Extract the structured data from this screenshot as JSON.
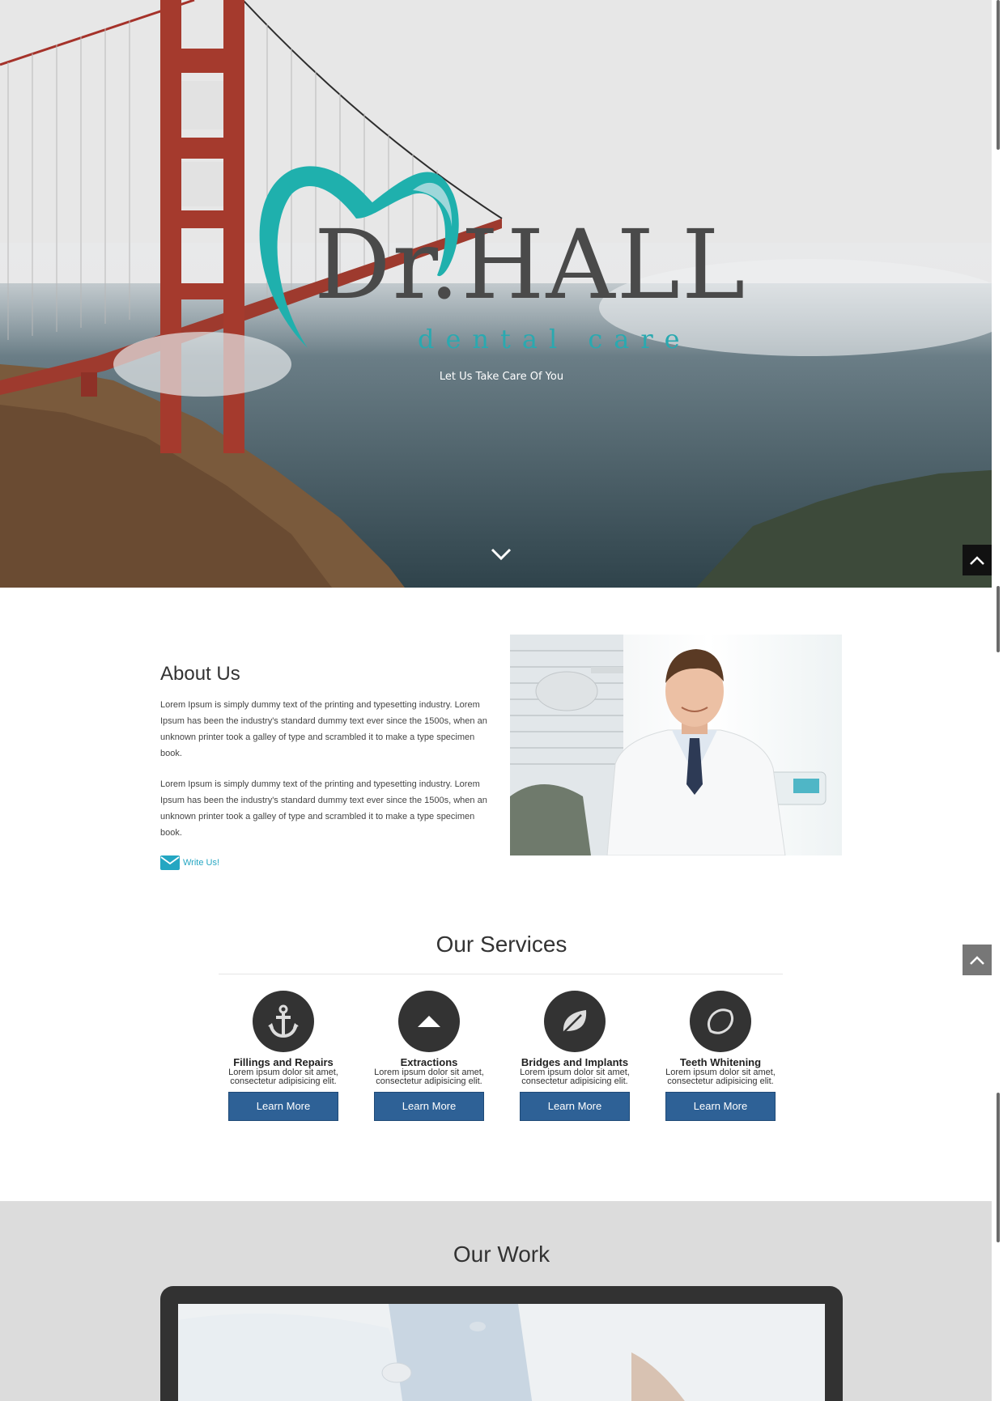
{
  "hero": {
    "logo_title": "Dr.HALL",
    "logo_subtitle": "dental care",
    "tagline": "Let Us Take Care Of You",
    "scroll_down_icon": "chevron-down-icon",
    "back_to_top_icon": "chevron-up-icon"
  },
  "about": {
    "title": "About Us",
    "paragraphs": [
      "Lorem Ipsum is simply dummy text of the printing and typesetting industry. Lorem Ipsum has been the industry's standard dummy text ever since the 1500s, when an unknown printer took a galley of type and scrambled it to make a type specimen book.",
      "Lorem Ipsum is simply dummy text of the printing and typesetting industry. Lorem Ipsum has been the industry's standard dummy text ever since the 1500s, when an unknown printer took a galley of type and scrambled it to make a type specimen book."
    ],
    "write_us": "Write Us!",
    "write_us_icon": "envelope-icon"
  },
  "services": {
    "title": "Our Services",
    "items": [
      {
        "name": "Fillings and Repairs",
        "desc": "Lorem ipsum dolor sit amet, consectetur adipisicing elit.",
        "button": "Learn More",
        "icon": "anchor-icon"
      },
      {
        "name": "Extractions",
        "desc": "Lorem ipsum dolor sit amet, consectetur adipisicing elit.",
        "button": "Learn More",
        "icon": "triangle-up-icon"
      },
      {
        "name": "Bridges and Implants",
        "desc": "Lorem ipsum dolor sit amet, consectetur adipisicing elit.",
        "button": "Learn More",
        "icon": "leaf-icon"
      },
      {
        "name": "Teeth Whitening",
        "desc": "Lorem ipsum dolor sit amet, consectetur adipisicing elit.",
        "button": "Learn More",
        "icon": "lemon-icon"
      }
    ]
  },
  "work": {
    "title": "Our Work"
  },
  "colors": {
    "accent_teal": "#2aa9b0",
    "button_blue": "#2e6196",
    "link_blue": "#24a6c2",
    "icon_circle": "#333333"
  }
}
